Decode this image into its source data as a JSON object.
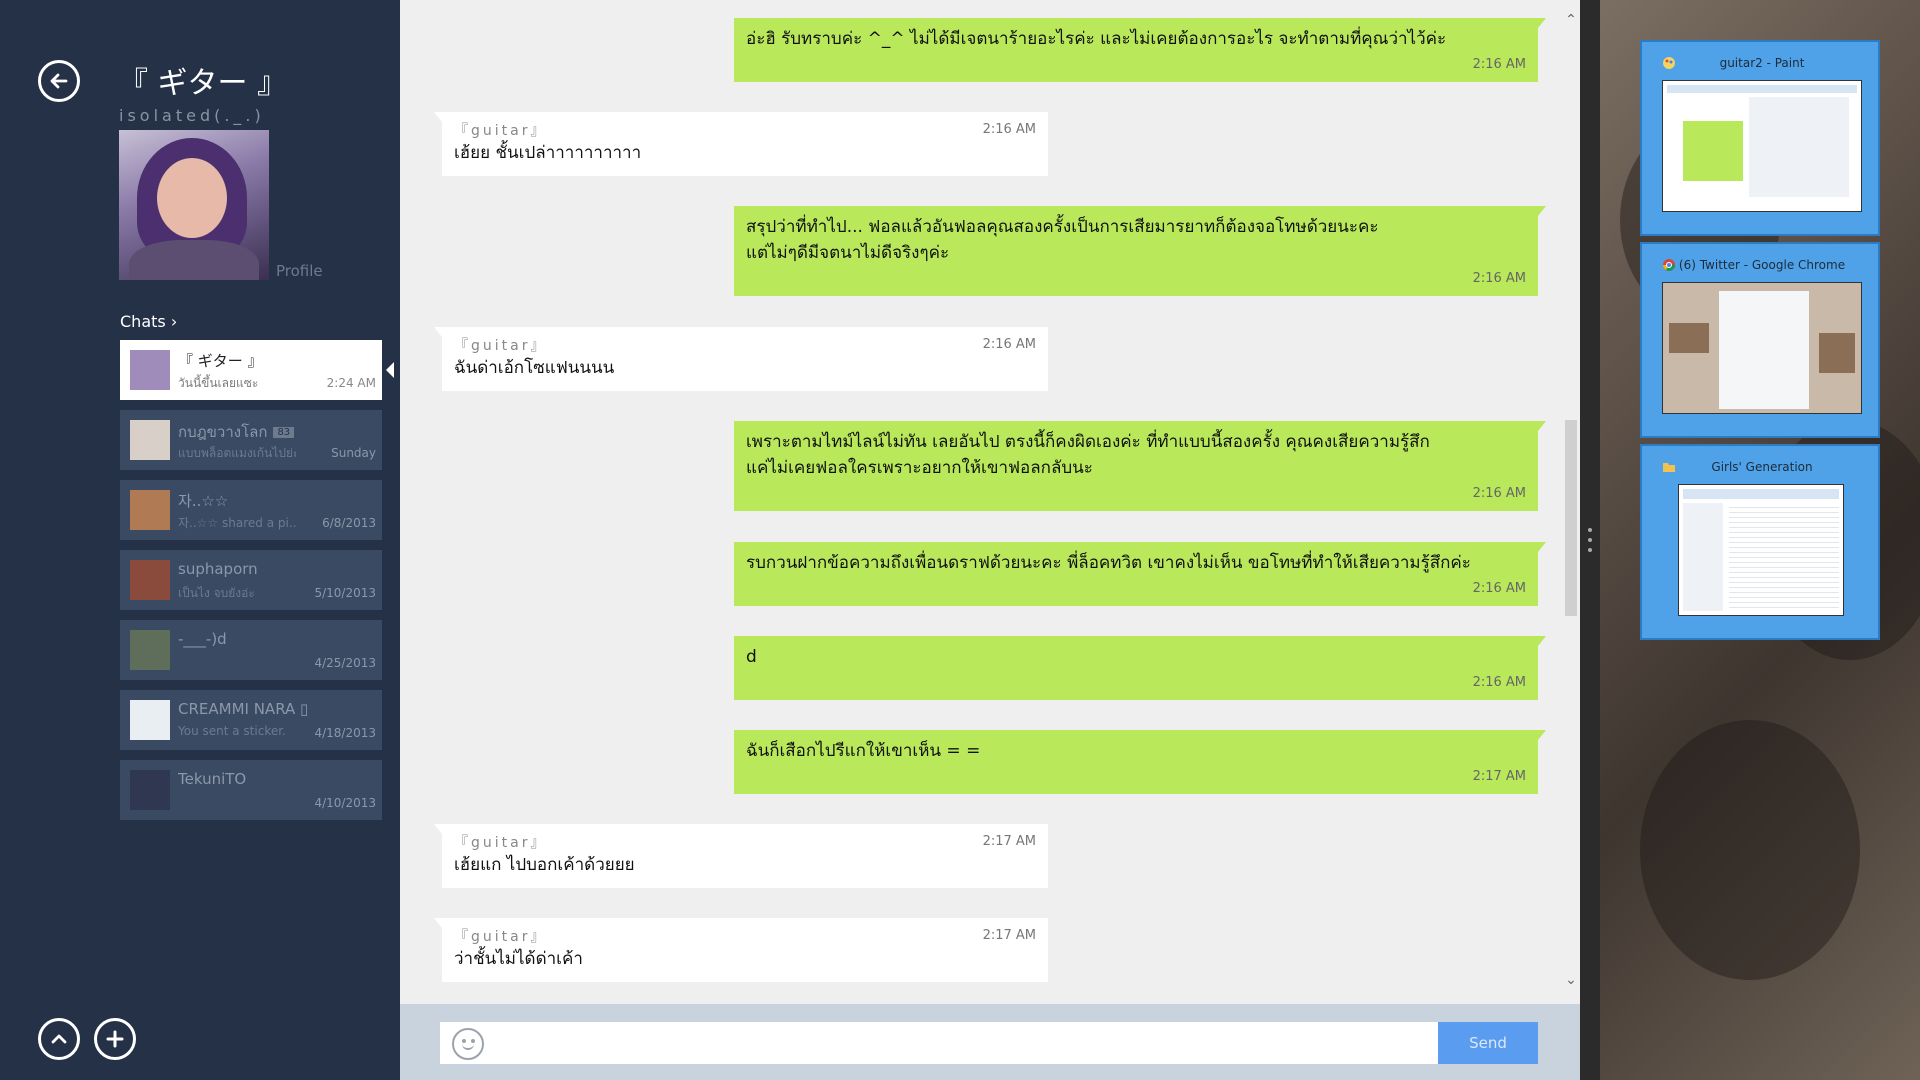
{
  "sidebar": {
    "profile_name": "『 ギター 』",
    "profile_status": "isolated(._.)",
    "profile_link": "Profile",
    "chats_title": "Chats",
    "chats": [
      {
        "name": "『 ギター 』",
        "preview": "วันนี้ขึ้นเลยแซะ",
        "date": "2:24 AM",
        "active": true
      },
      {
        "name": "กบฎขวางโลก",
        "badge": "83",
        "preview": "แบบพล็อตแมงเก้นไปย่ะ",
        "date": "Sunday"
      },
      {
        "name": "자..☆☆",
        "preview": "자..☆☆ shared a pi...",
        "date": "6/8/2013"
      },
      {
        "name": "suphaporn",
        "preview": "เป็นไง จบยังอ่ะ",
        "date": "5/10/2013"
      },
      {
        "name": "-___-)d",
        "preview": "",
        "date": "4/25/2013"
      },
      {
        "name": "CREAMMI NARA ▯",
        "preview": "You sent a sticker.",
        "date": "4/18/2013"
      },
      {
        "name": "TekuniTO",
        "preview": "",
        "date": "4/10/2013"
      }
    ]
  },
  "conversation": {
    "messages": [
      {
        "dir": "out",
        "text": "อ่ะฮิ รับทราบค่ะ ^_^ ไม่ได้มีเจตนาร้ายอะไรค่ะ และไม่เคยต้องการอะไร จะทำตามที่คุณว่าไว้ค่ะ",
        "time": "2:16 AM"
      },
      {
        "dir": "in",
        "sender": "『guitar』",
        "text": "เฮ้ยย ชั้นเปล่าาาาาาาาาา",
        "time": "2:16 AM"
      },
      {
        "dir": "out",
        "text": "สรุปว่าที่ทำไป... ฟอลแล้วอันฟอลคุณสองครั้งเป็นการเสียมารยาทก็ต้องจอโทษด้วยนะคะ",
        "text2": "แต่ไม่ๆดีมีจตนาไม่ดีจริงๆค่ะ",
        "time": "2:16 AM"
      },
      {
        "dir": "in",
        "sender": "『guitar』",
        "text": "ฉันด่าเอ้กโซแฟนนนน",
        "time": "2:16 AM"
      },
      {
        "dir": "out",
        "text": "เพราะตามไทม์ไลน์ไม่ทัน เลยอันไป ตรงนี้ก็คงผิดเองค่ะ ที่ทำแบบนี้สองครั้ง คุณคงเสียความรู้สึก",
        "text2": "แค่ไม่เคยฟอลใครเพราะอยากให้เขาฟอลกลับนะ",
        "time": "2:16 AM"
      },
      {
        "dir": "out",
        "text": "รบกวนฝากข้อความถึงเพื่อนดราฟด้วยนะคะ พี่ล็อคทวิต เขาคงไม่เห็น ขอโทษที่ทำให้เสียความรู้สึกค่ะ",
        "time": "2:16 AM"
      },
      {
        "dir": "out",
        "text": "d",
        "time": "2:16 AM"
      },
      {
        "dir": "out",
        "text": "ฉันก็เสือกไปรีแกให้เขาเห็น = =",
        "time": "2:17 AM"
      },
      {
        "dir": "in",
        "sender": "『guitar』",
        "text": "เฮ้ยแก ไปบอกเค้าด้วยยย",
        "time": "2:17 AM"
      },
      {
        "dir": "in",
        "sender": "『guitar』",
        "text": "ว่าชั้นไม่ได้ด่าเค้า",
        "time": "2:17 AM"
      }
    ],
    "input_placeholder": "",
    "send_label": "Send"
  },
  "switcher": {
    "apps": [
      {
        "title": "guitar2 - Paint",
        "icon": "paint-icon"
      },
      {
        "title": "(6) Twitter - Google Chrome",
        "icon": "chrome-icon"
      },
      {
        "title": "Girls' Generation",
        "icon": "folder-icon"
      }
    ]
  },
  "colors": {
    "sidebar_bg": "#243147",
    "outgoing_bubble": "#b9e95a",
    "incoming_bubble": "#ffffff",
    "send_button": "#5a9cf0",
    "switcher_tile": "#4fa2e8"
  }
}
